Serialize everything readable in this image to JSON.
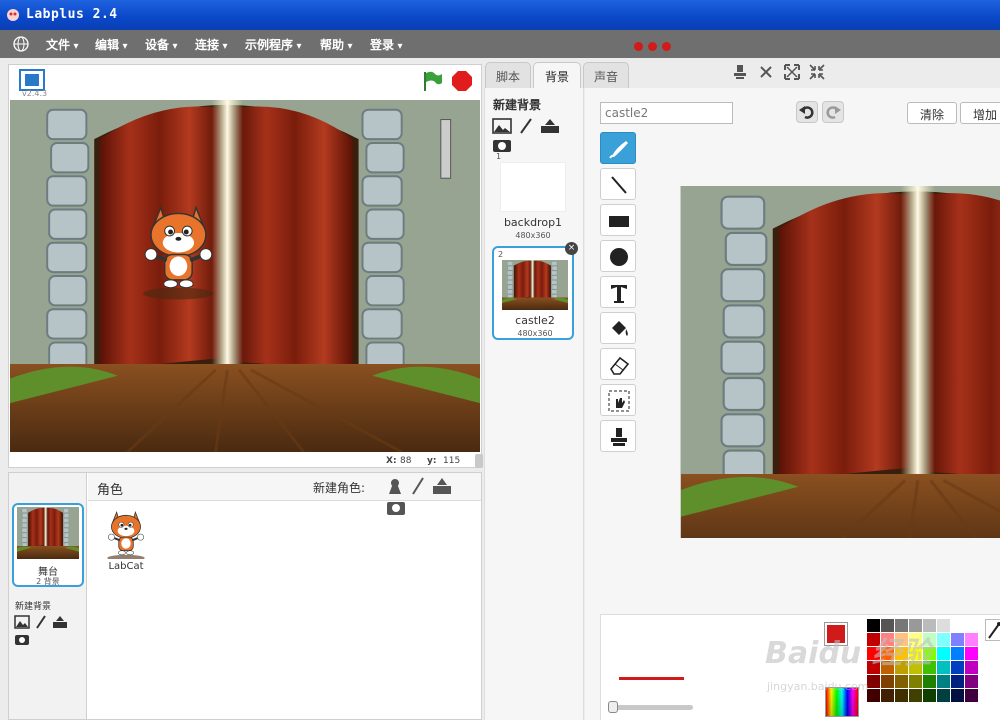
{
  "window": {
    "title": "Labplus 2.4"
  },
  "menu": {
    "items": [
      {
        "label": "文件"
      },
      {
        "label": "编辑"
      },
      {
        "label": "设备"
      },
      {
        "label": "连接"
      },
      {
        "label": "示例程序"
      },
      {
        "label": "帮助"
      },
      {
        "label": "登录"
      }
    ]
  },
  "stage": {
    "version": "v2.4.3",
    "x_label": "X:",
    "x_value": "88",
    "y_label": "y:",
    "y_value": "115"
  },
  "sprites": {
    "header": "角色",
    "new_sprite_label": "新建角色:",
    "stage_label": "舞台",
    "stage_count": "2 背景",
    "new_backdrop_label": "新建背景",
    "items": [
      {
        "name": "LabCat"
      }
    ]
  },
  "tabs": [
    {
      "label": "脚本"
    },
    {
      "label": "背景",
      "active": true
    },
    {
      "label": "声音"
    }
  ],
  "backdrops": {
    "header": "新建背景",
    "items": [
      {
        "number": "1",
        "name": "backdrop1",
        "size": "480x360"
      },
      {
        "number": "2",
        "name": "castle2",
        "size": "480x360",
        "selected": true
      }
    ]
  },
  "paint_editor": {
    "name_value": "castle2",
    "clear_label": "清除",
    "add_label": "增加",
    "current_color": "#d11a1a",
    "palette": [
      "#000000",
      "#555555",
      "#777777",
      "#999999",
      "#bbbbbb",
      "#dddddd",
      "#ffffff",
      "#ffffff",
      "#c00000",
      "#ff8080",
      "#ffc080",
      "#ffff80",
      "#c0ffc0",
      "#80ffff",
      "#8080ff",
      "#ff80ff",
      "#ff0000",
      "#ff6000",
      "#ffc000",
      "#ffff00",
      "#80ff00",
      "#00ffff",
      "#0080ff",
      "#ff00ff",
      "#c00000",
      "#c06000",
      "#c0a000",
      "#c0c000",
      "#40c000",
      "#00c0c0",
      "#0040c0",
      "#c000c0",
      "#800000",
      "#804000",
      "#806000",
      "#808000",
      "#208000",
      "#008080",
      "#002080",
      "#800080",
      "#400000",
      "#402000",
      "#403000",
      "#404000",
      "#104000",
      "#004040",
      "#001040",
      "#400040"
    ]
  },
  "watermark": {
    "brand": "Baidu 经验",
    "url": "jingyan.baidu.com"
  }
}
